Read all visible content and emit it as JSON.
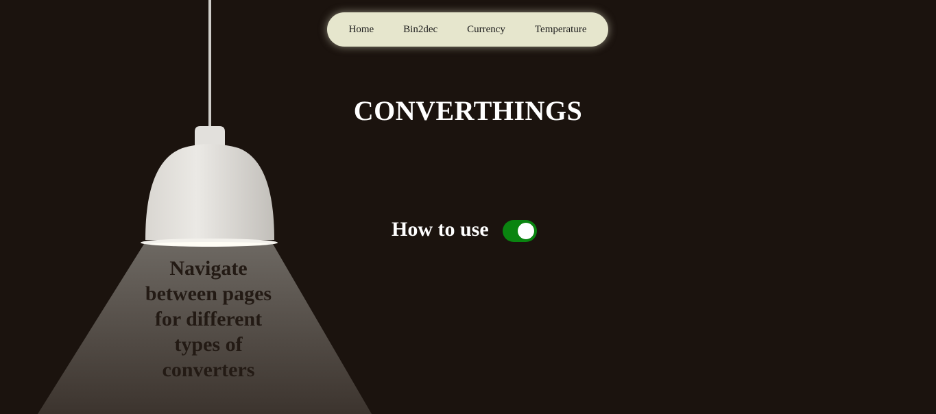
{
  "nav": {
    "items": [
      {
        "label": "Home"
      },
      {
        "label": "Bin2dec"
      },
      {
        "label": "Currency"
      },
      {
        "label": "Temperature"
      }
    ]
  },
  "page": {
    "title": "CONVERTHINGS"
  },
  "how_to_use": {
    "label": "How to use",
    "toggle_on": true
  },
  "lamp": {
    "beam_text": "Navigate between pages for different types of converters"
  },
  "colors": {
    "background": "#1b130e",
    "nav_background": "#e6e6cd",
    "toggle_on": "#0a8410",
    "beam_text": "#231a14"
  }
}
